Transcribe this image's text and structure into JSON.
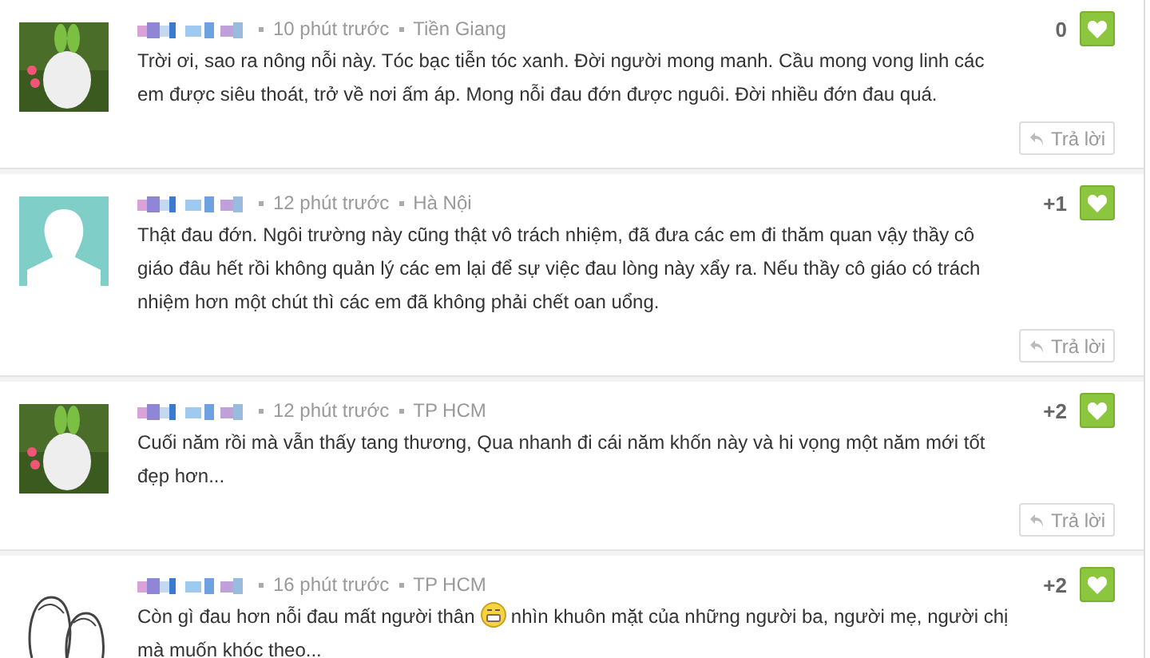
{
  "comments": [
    {
      "time": "10 phút trước",
      "location": "Tiền Giang",
      "score": "0",
      "body": [
        {
          "kind": "text",
          "text": "Trời ơi, sao ra nông nỗi này. Tóc bạc tiễn tóc xanh. Đời người mong manh. Cầu mong vong linh các em được siêu thoát, trở về nơi ấm áp. Mong nỗi đau đớn được nguôi. Đời nhiều đớn đau quá."
        }
      ],
      "reply": "Trả lời"
    },
    {
      "avatar": {
        "kind": "silhouette"
      },
      "time": "12 phút trước",
      "location": "Hà Nội",
      "score": "+1",
      "body": [
        {
          "kind": "text",
          "text": "Thật đau đớn. Ngôi trường này cũng thật vô trách nhiệm, đã đưa các em đi thăm quan vậy thầy cô giáo đâu hết rồi không quản lý các em lại để sự việc đau lòng này xẩy ra. Nếu thầy cô giáo có trách nhiệm hơn một chút thì các em đã không phải chết oan uổng."
        }
      ],
      "reply": "Trả lời"
    },
    {
      "time": "12 phút trước",
      "location": "TP HCM",
      "score": "+2",
      "body": [
        {
          "kind": "text",
          "text": "Cuối năm rồi mà vẫn thấy tang thương, Qua nhanh đi cái năm khốn này và hi vọng một năm mới tốt đẹp hơn..."
        }
      ],
      "reply": "Trả lời"
    },
    {
      "avatar": {
        "kind": "sketch"
      },
      "time": "16 phút trước",
      "location": "TP HCM",
      "score": "+2",
      "body": [
        {
          "kind": "text",
          "text": "Còn gì đau hơn nỗi đau mất người thân "
        },
        {
          "kind": "emoji"
        },
        {
          "kind": "text",
          "text": " nhìn khuôn mặt của những người ba, người mẹ, người chị mà muốn khóc theo..."
        }
      ]
    }
  ]
}
